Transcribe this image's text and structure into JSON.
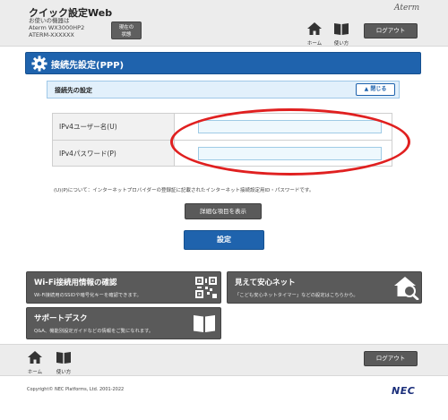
{
  "header": {
    "app_title": "クイック設定Web",
    "device_label": "お使いの機器は",
    "model": "Aterm WX3000HP2",
    "device_id": "ATERM-XXXXXX",
    "status_button": [
      "現在の",
      "状態"
    ],
    "brand": "Aterm",
    "home_label": "ホーム",
    "manual_label": "使い方",
    "logout_label": "ログアウト"
  },
  "section": {
    "title": "接続先設定(PPP)"
  },
  "panel": {
    "title": "接続先の設定",
    "collapse_label": "閉じる"
  },
  "form": {
    "rows": [
      {
        "label": "IPv4ユーザー名(U)",
        "value": ""
      },
      {
        "label": "IPv4パスワード(P)",
        "value": ""
      }
    ]
  },
  "note": "(U)(P)について：インターネットプロバイダーの登録証に記載されたインターネット接続設定用ID・パスワードです。",
  "buttons": {
    "detail": "詳細な項目を表示",
    "set": "設定"
  },
  "tiles": [
    {
      "title": "Wi-Fi接続用情報の確認",
      "desc": "Wi-Fi接続用のSSIDや暗号化キーを確認できます。",
      "icon": "qr-code-icon"
    },
    {
      "title": "見えて安心ネット",
      "desc": "「こども安心ネットタイマー」などの設定はこちらから。",
      "icon": "house-search-icon"
    },
    {
      "title": "サポートデスク",
      "desc": "Q&A、機能別設定ガイドなどの情報をご覧になれます。",
      "icon": "book-icon"
    }
  ],
  "footer": {
    "home_label": "ホーム",
    "manual_label": "使い方",
    "logout_label": "ログアウト",
    "copyright": "Copyright© NEC Platforms, Ltd. 2001-2022",
    "logo": "NEC"
  },
  "colors": {
    "accent_blue": "#1f63ad",
    "button_gray": "#5a5a5a",
    "highlight_red": "#e02020"
  }
}
